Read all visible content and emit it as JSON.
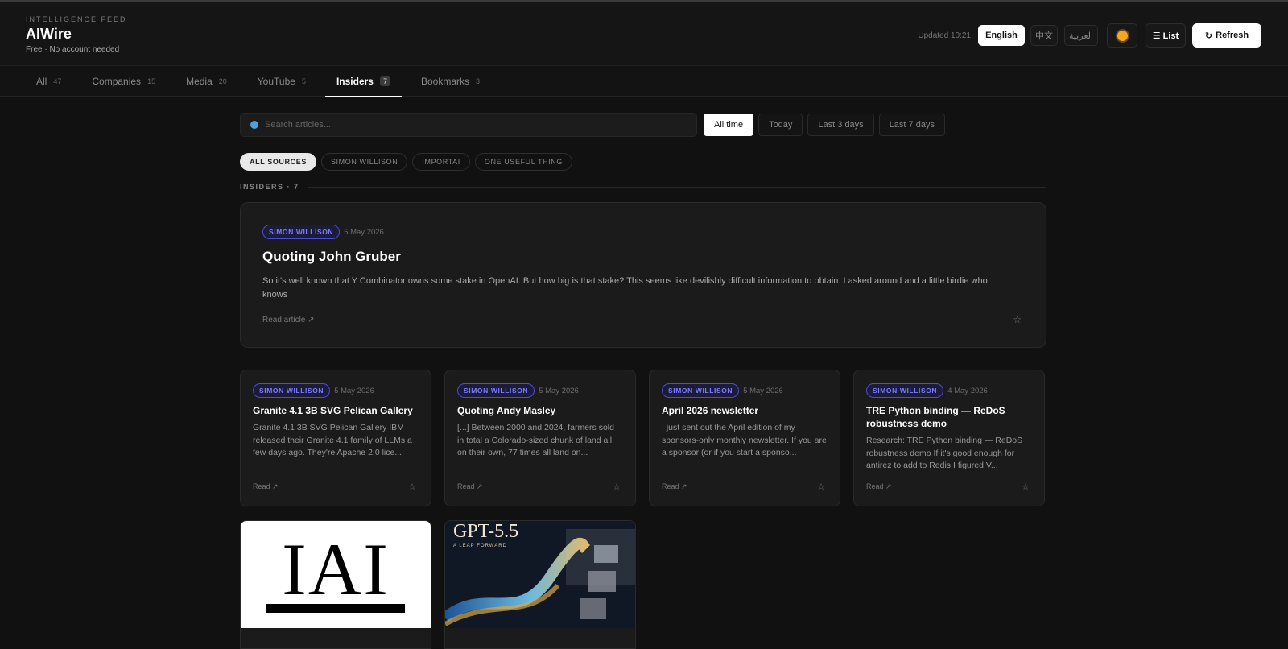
{
  "header": {
    "eyebrow": "INTELLIGENCE FEED",
    "app_name": "AIWire",
    "tagline": "Free · No account needed",
    "updated": "Updated 10:21",
    "languages": {
      "english": "English",
      "chinese": "中文",
      "arabic": "العربية"
    },
    "list_label": "☰ List",
    "refresh_label": "Refresh",
    "refresh_icon": "↻"
  },
  "tabs": [
    {
      "label": "All",
      "count": "47"
    },
    {
      "label": "Companies",
      "count": "15"
    },
    {
      "label": "Media",
      "count": "20"
    },
    {
      "label": "YouTube",
      "count": "5"
    },
    {
      "label": "Insiders",
      "count": "7"
    },
    {
      "label": "Bookmarks",
      "count": "3"
    }
  ],
  "search": {
    "placeholder": "Search articles..."
  },
  "ranges": [
    "All time",
    "Today",
    "Last 3 days",
    "Last 7 days"
  ],
  "sources": [
    "ALL SOURCES",
    "SIMON WILLISON",
    "IMPORTAI",
    "ONE USEFUL THING"
  ],
  "section_label": "INSIDERS · 7",
  "featured": {
    "source": "SIMON WILLISON",
    "date": "5 May 2026",
    "title": "Quoting John Gruber",
    "excerpt": "So it's well known that Y Combinator owns some stake in OpenAI. But how big is that stake? This seems like devilishly difficult information to obtain. I asked around and a little birdie who knows",
    "read_label": "Read article ↗",
    "star": "☆"
  },
  "cards": [
    {
      "source": "SIMON WILLISON",
      "date": "5 May 2026",
      "title": "Granite 4.1 3B SVG Pelican Gallery",
      "excerpt": "Granite 4.1 3B SVG Pelican Gallery IBM released their Granite 4.1 family of LLMs a few days ago. They're Apache 2.0 lice...",
      "read_label": "Read ↗",
      "star": "☆"
    },
    {
      "source": "SIMON WILLISON",
      "date": "5 May 2026",
      "title": "Quoting Andy Masley",
      "excerpt": "[...] Between 2000 and 2024, farmers sold in total a Colorado-sized chunk of land all on their own, 77 times all land on...",
      "read_label": "Read ↗",
      "star": "☆"
    },
    {
      "source": "SIMON WILLISON",
      "date": "5 May 2026",
      "title": "April 2026 newsletter",
      "excerpt": "I just sent out the April edition of my sponsors-only monthly newsletter. If you are a sponsor (or if you start a sponso...",
      "read_label": "Read ↗",
      "star": "☆"
    },
    {
      "source": "SIMON WILLISON",
      "date": "4 May 2026",
      "title": "TRE Python binding — ReDoS robustness demo",
      "excerpt": "Research: TRE Python binding — ReDoS robustness demo If it's good enough for antirez to add to Redis I figured V...",
      "read_label": "Read ↗",
      "star": "☆"
    }
  ],
  "image_cards": [
    {
      "logo_text": "IAI"
    },
    {
      "title": "GPT-5.5",
      "subtitle": "A LEAP FORWARD"
    }
  ]
}
